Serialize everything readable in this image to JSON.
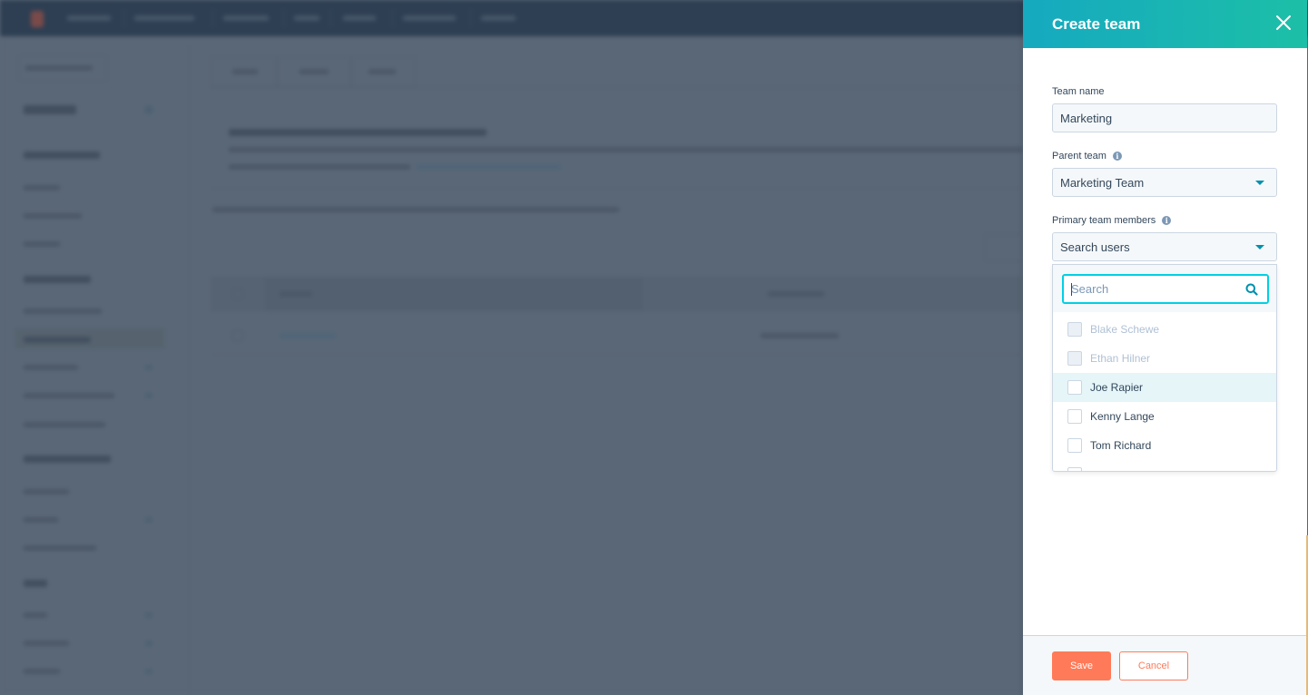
{
  "background": {
    "note_state": "blurred-behind-overlay",
    "topnav_item_count": 7,
    "sidebar_section_count": 4,
    "tab_count": 3
  },
  "panel": {
    "title": "Create team",
    "close_icon": "close-icon",
    "fields": {
      "team_name": {
        "label": "Team name",
        "value": "Marketing"
      },
      "parent_team": {
        "label": "Parent team",
        "info_icon": "info-icon",
        "selected": "Marketing Team"
      },
      "primary_members": {
        "label": "Primary team members",
        "info_icon": "info-icon",
        "placeholder": "Search users",
        "dropdown": {
          "search_placeholder": "Search",
          "search_icon": "search-icon",
          "options": [
            {
              "label": "Blake Schewe",
              "disabled": true,
              "checked": false
            },
            {
              "label": "Ethan Hilner",
              "disabled": true,
              "checked": false
            },
            {
              "label": "Joe Rapier",
              "disabled": false,
              "checked": false,
              "hovered": true
            },
            {
              "label": "Kenny Lange",
              "disabled": false,
              "checked": false
            },
            {
              "label": "Tom Richard",
              "disabled": false,
              "checked": false
            }
          ]
        }
      }
    },
    "footer": {
      "save_label": "Save",
      "cancel_label": "Cancel"
    },
    "colors": {
      "header_gradient_start": "#16a9c0",
      "header_gradient_end": "#1cbfa7",
      "primary_button": "#ff7a59",
      "focus_border": "#00d0e4",
      "caret": "#0091ae"
    }
  }
}
